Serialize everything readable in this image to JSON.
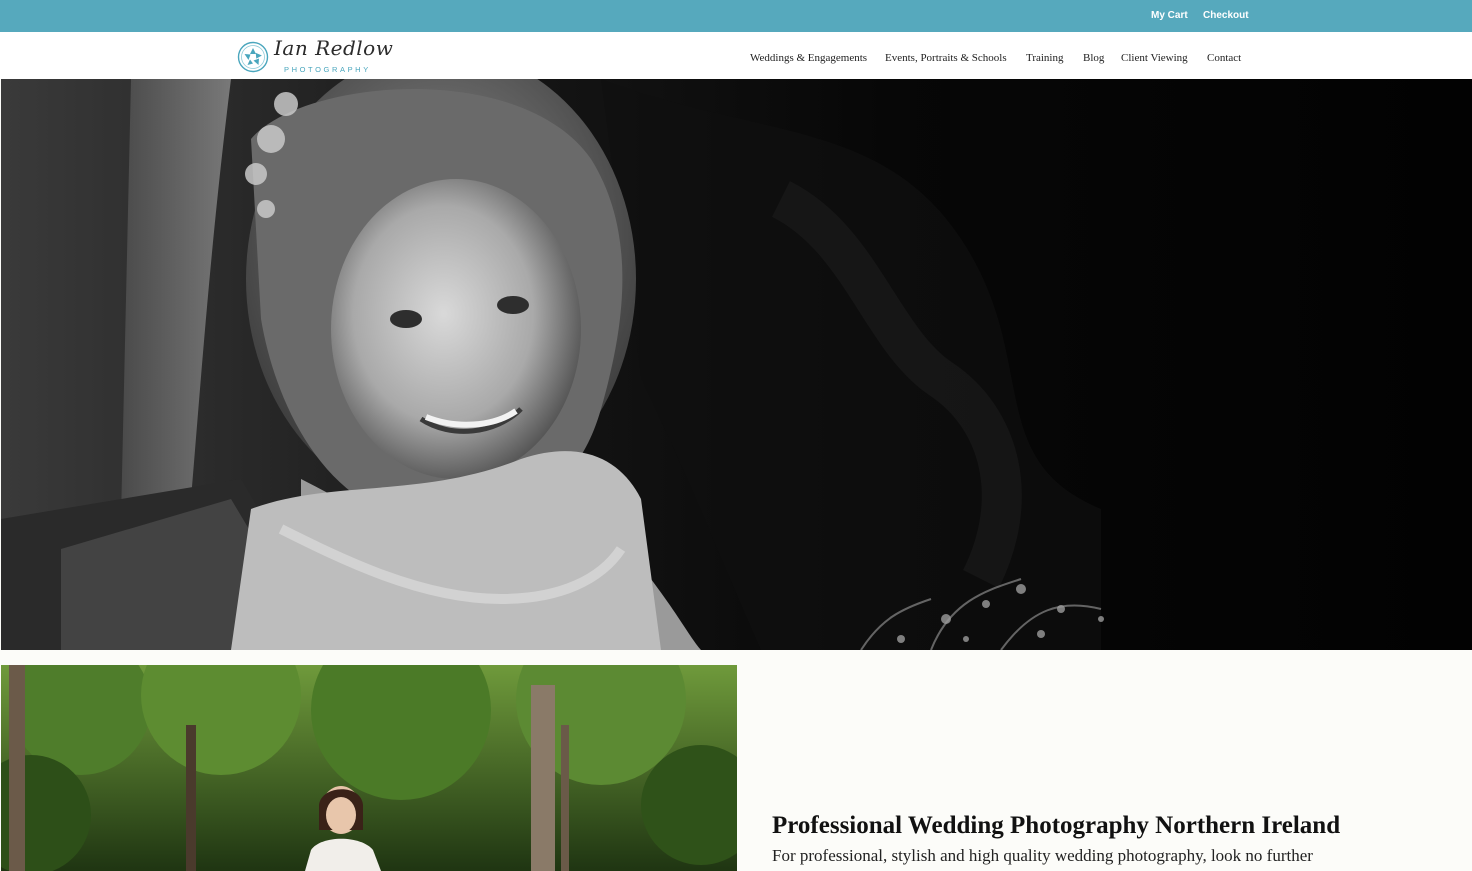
{
  "topbar": {
    "cart_label": "My Cart",
    "checkout_label": "Checkout",
    "background": "#56a9bd"
  },
  "brand": {
    "name": "Ian Redlow",
    "subtitle": "PHOTOGRAPHY",
    "accent": "#4aa6bd",
    "logo_icon": "aperture-icon"
  },
  "nav": {
    "items": [
      {
        "label": "Weddings & Engagements"
      },
      {
        "label": "Events, Portraits & Schools"
      },
      {
        "label": "Training"
      },
      {
        "label": "Blog"
      },
      {
        "label": "Client Viewing"
      },
      {
        "label": "Contact"
      }
    ]
  },
  "hero": {
    "image": "black-and-white-bride-portrait"
  },
  "gallery": {
    "image": "bride-in-garden-photo"
  },
  "intro": {
    "title": "Professional Wedding Photography Northern Ireland",
    "text": "For professional, stylish and high quality wedding photography, look no further"
  }
}
